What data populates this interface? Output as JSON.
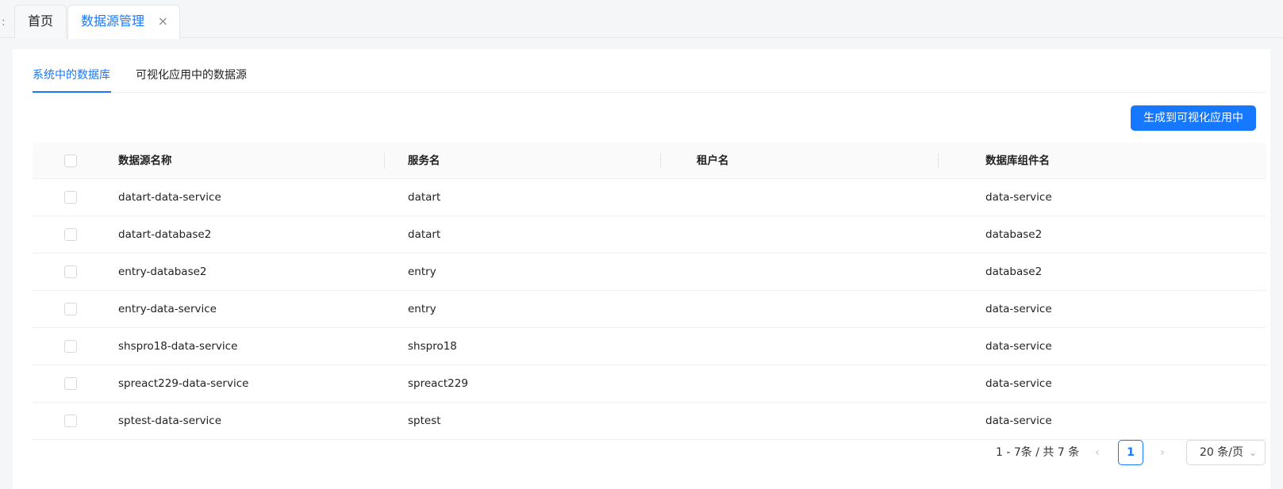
{
  "tabs": [
    {
      "label": "首页"
    },
    {
      "label": "数据源管理",
      "close_icon": "×"
    }
  ],
  "subtabs": [
    {
      "label": "系统中的数据库"
    },
    {
      "label": "可视化应用中的数据源"
    }
  ],
  "actions": {
    "generate_label": "生成到可视化应用中"
  },
  "table": {
    "headers": [
      "数据源名称",
      "服务名",
      "租户名",
      "数据库组件名"
    ],
    "rows": [
      {
        "name": "datart-data-service",
        "service": "datart",
        "tenant": "",
        "component": "data-service"
      },
      {
        "name": "datart-database2",
        "service": "datart",
        "tenant": "",
        "component": "database2"
      },
      {
        "name": "entry-database2",
        "service": "entry",
        "tenant": "",
        "component": "database2"
      },
      {
        "name": "entry-data-service",
        "service": "entry",
        "tenant": "",
        "component": "data-service"
      },
      {
        "name": "shspro18-data-service",
        "service": "shspro18",
        "tenant": "",
        "component": "data-service"
      },
      {
        "name": "spreact229-data-service",
        "service": "spreact229",
        "tenant": "",
        "component": "data-service"
      },
      {
        "name": "sptest-data-service",
        "service": "sptest",
        "tenant": "",
        "component": "data-service"
      }
    ]
  },
  "pagination": {
    "total_text": "1 - 7条 / 共 7 条",
    "current_page": "1",
    "page_size": "20 条/页",
    "prev_icon": "‹",
    "next_icon": "›",
    "dropdown_icon": "⌄"
  },
  "colors": {
    "accent": "#1677ff"
  }
}
